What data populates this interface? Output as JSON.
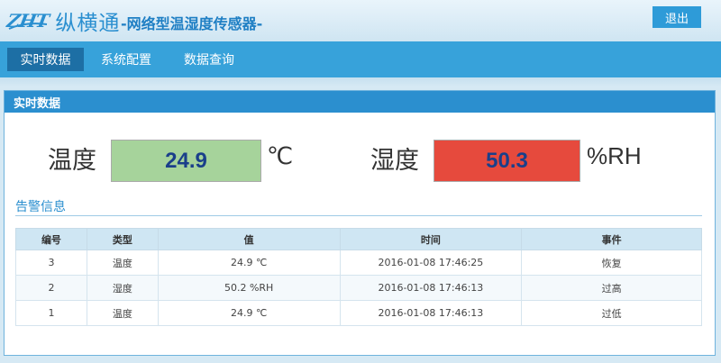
{
  "header": {
    "logo_mark": "ZHT",
    "logo_text": "纵横通",
    "app_title": "-网络型温湿度传感器-",
    "logout_label": "退出"
  },
  "nav": {
    "items": [
      {
        "label": "实时数据",
        "active": true
      },
      {
        "label": "系统配置",
        "active": false
      },
      {
        "label": "数据查询",
        "active": false
      }
    ]
  },
  "panel": {
    "title": "实时数据",
    "temperature": {
      "label": "温度",
      "value": "24.9",
      "unit": "℃",
      "color": "#a6d39b"
    },
    "humidity": {
      "label": "湿度",
      "value": "50.3",
      "unit": "%RH",
      "color": "#e64a3d"
    },
    "alarm_title": "告警信息",
    "table": {
      "headers": [
        "编号",
        "类型",
        "值",
        "时间",
        "事件"
      ],
      "rows": [
        [
          "3",
          "温度",
          "24.9 ℃",
          "2016-01-08 17:46:25",
          "恢复"
        ],
        [
          "2",
          "湿度",
          "50.2 %RH",
          "2016-01-08 17:46:13",
          "过高"
        ],
        [
          "1",
          "温度",
          "24.9 ℃",
          "2016-01-08 17:46:13",
          "过低"
        ]
      ]
    }
  }
}
